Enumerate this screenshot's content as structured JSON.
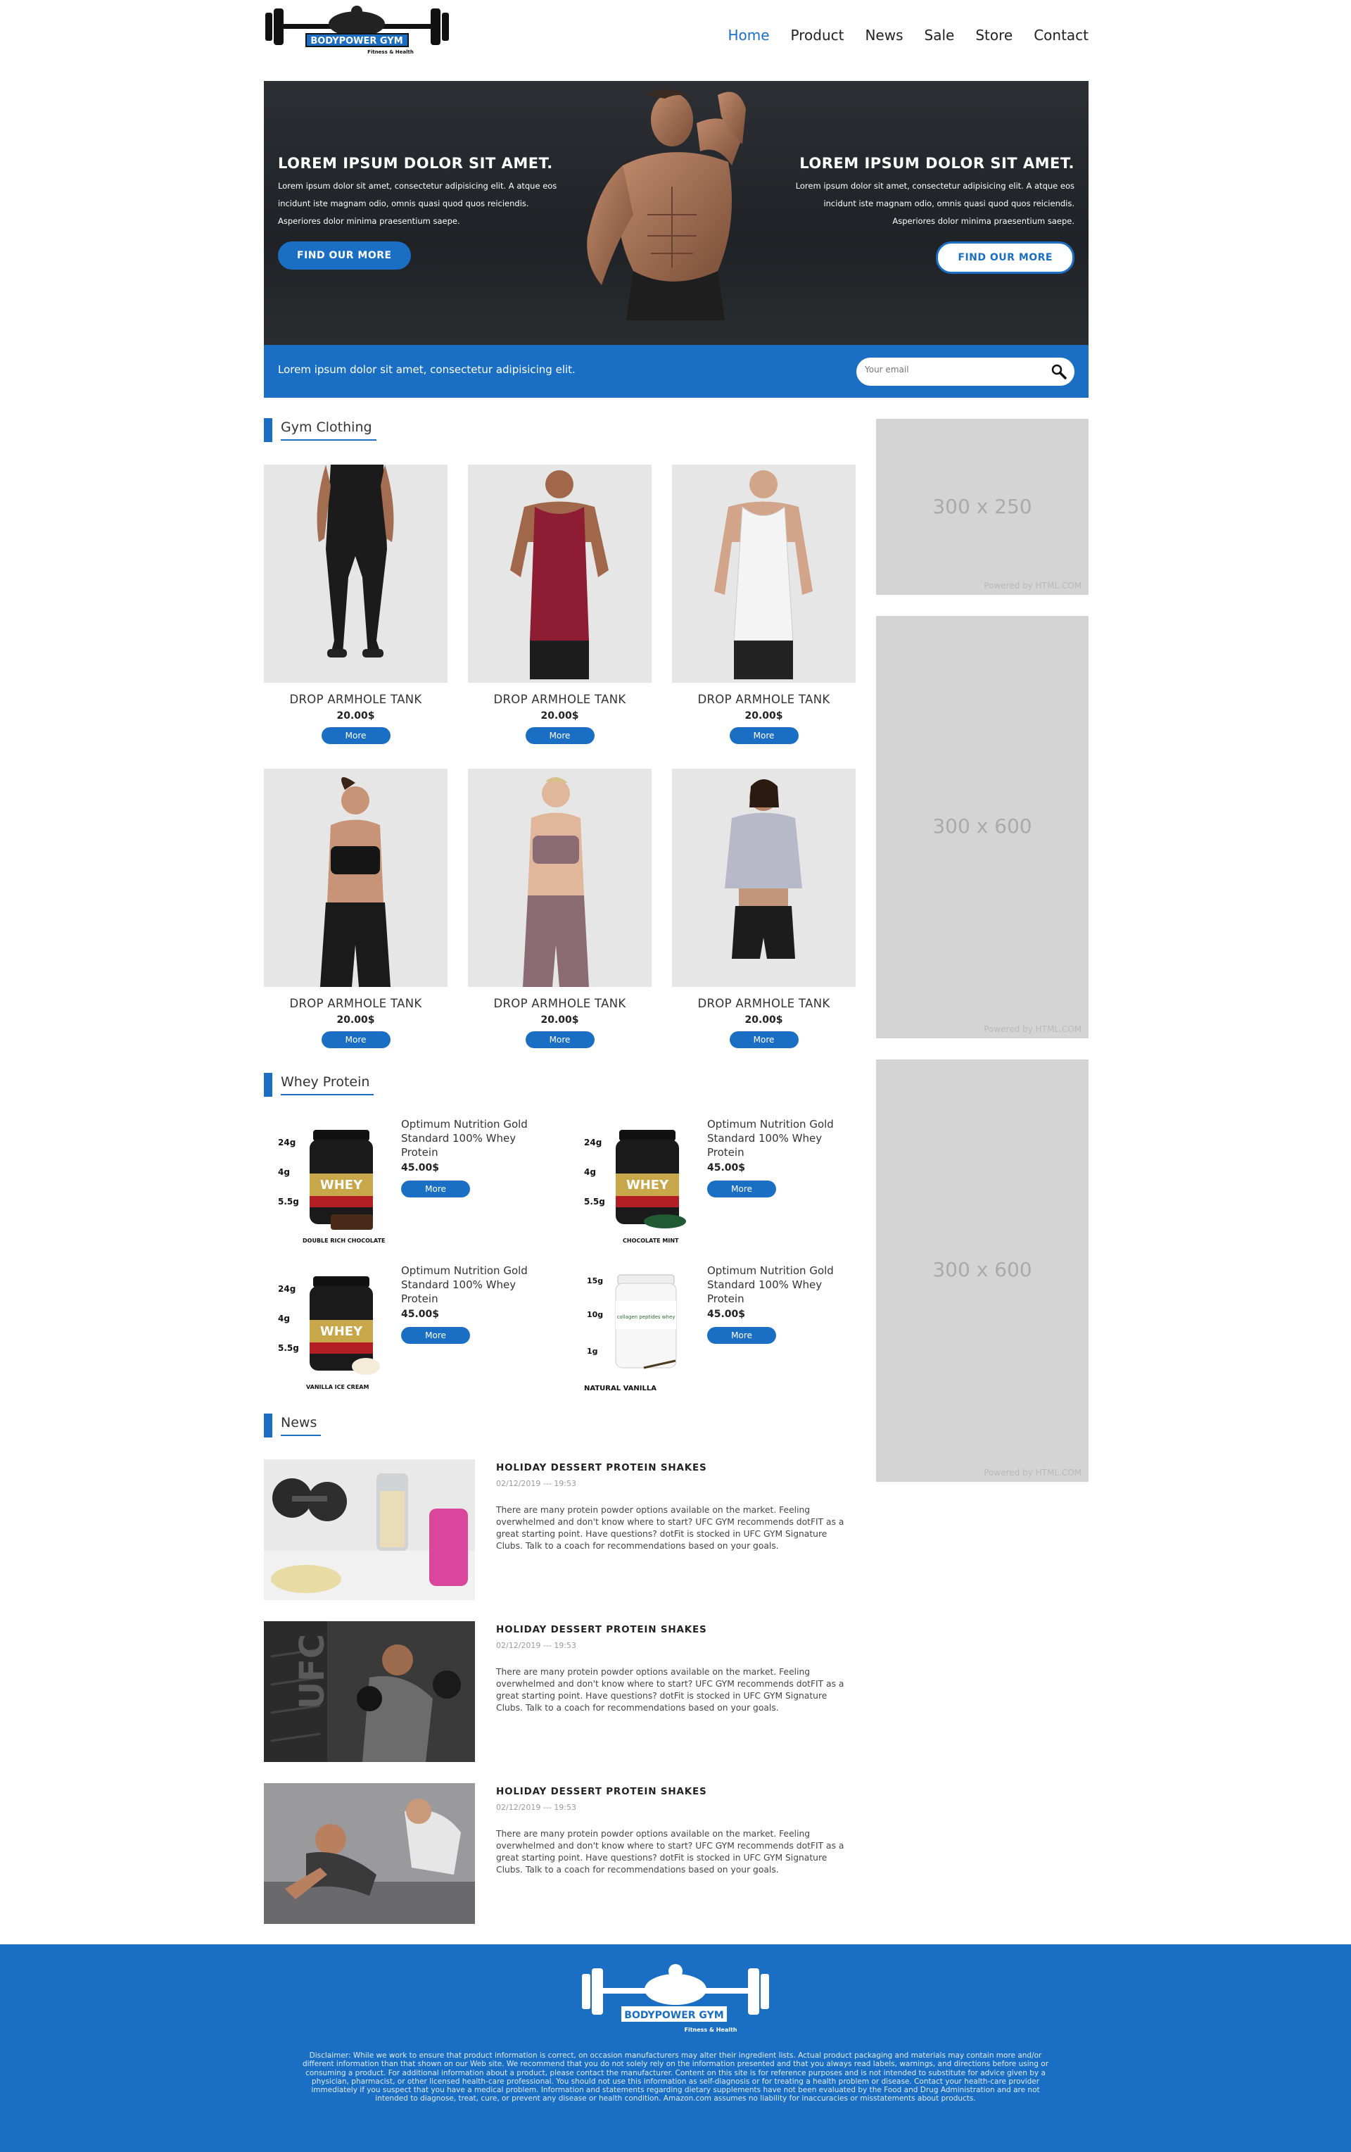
{
  "brand": {
    "logo_text": "BODYPOWER GYM",
    "logo_sub": "Fitness & Health"
  },
  "nav": [
    {
      "label": "Home",
      "active": true
    },
    {
      "label": "Product",
      "active": false
    },
    {
      "label": "News",
      "active": false
    },
    {
      "label": "Sale",
      "active": false
    },
    {
      "label": "Store",
      "active": false
    },
    {
      "label": "Contact",
      "active": false
    }
  ],
  "hero": {
    "left": {
      "title": "LOREM IPSUM DOLOR SIT AMET.",
      "lines": [
        "Lorem ipsum dolor sit amet, consectetur adipisicing elit. A atque eos",
        "incidunt iste magnam odio, omnis quasi quod quos reiciendis.",
        "Asperiores dolor minima praesentium saepe."
      ],
      "button": "FIND OUR MORE"
    },
    "right": {
      "title": "LOREM IPSUM DOLOR SIT AMET.",
      "lines": [
        "Lorem ipsum dolor sit amet, consectetur adipisicing elit. A atque eos",
        "incidunt iste magnam odio, omnis quasi quod quos reiciendis.",
        "Asperiores dolor minima praesentium saepe."
      ],
      "button": "FIND OUR MORE"
    }
  },
  "subbar": {
    "text": "Lorem ipsum dolor sit amet, consectetur adipisicing elit.",
    "email_placeholder": "Your email",
    "search_icon": "search-icon"
  },
  "sections": {
    "clothing": "Gym Clothing",
    "whey": "Whey Protein",
    "news": "News"
  },
  "clothing": [
    {
      "name": "DROP ARMHOLE TANK",
      "price": "20.00$",
      "more": "More"
    },
    {
      "name": "DROP ARMHOLE TANK",
      "price": "20.00$",
      "more": "More"
    },
    {
      "name": "DROP ARMHOLE TANK",
      "price": "20.00$",
      "more": "More"
    },
    {
      "name": "DROP ARMHOLE TANK",
      "price": "20.00$",
      "more": "More"
    },
    {
      "name": "DROP ARMHOLE TANK",
      "price": "20.00$",
      "more": "More"
    },
    {
      "name": "DROP ARMHOLE TANK",
      "price": "20.00$",
      "more": "More"
    }
  ],
  "whey": [
    {
      "name": "Optimum Nutrition Gold Standard 100% Whey Protein",
      "price": "45.00$",
      "more": "More",
      "flavor": "DOUBLE RICH CHOCOLATE",
      "label": "WHEY",
      "stats": [
        "24g",
        "4g",
        "5.5g"
      ]
    },
    {
      "name": "Optimum Nutrition Gold Standard 100% Whey Protein",
      "price": "45.00$",
      "more": "More",
      "flavor": "CHOCOLATE MINT",
      "label": "WHEY",
      "stats": [
        "24g",
        "4g",
        "5.5g"
      ]
    },
    {
      "name": "Optimum Nutrition Gold Standard 100% Whey Protein",
      "price": "45.00$",
      "more": "More",
      "flavor": "VANILLA ICE CREAM",
      "label": "WHEY",
      "stats": [
        "24g",
        "4g",
        "5.5g"
      ]
    },
    {
      "name": "Optimum Nutrition Gold Standard 100% Whey Protein",
      "price": "45.00$",
      "more": "More",
      "flavor": "NATURAL VANILLA",
      "label": "collagen peptides whey",
      "stats": [
        "15g",
        "10g",
        "1g"
      ]
    }
  ],
  "news": [
    {
      "title": "HOLIDAY DESSERT PROTEIN SHAKES",
      "date": "02/12/2019 --- 19:53",
      "text": "There are many protein powder options available on the market. Feeling overwhelmed and don't know where to start? UFC GYM recommends dotFIT as a great starting point. Have questions? dotFit is stocked in UFC GYM Signature Clubs. Talk to a coach for recommendations based on your goals."
    },
    {
      "title": "HOLIDAY DESSERT PROTEIN SHAKES",
      "date": "02/12/2019 --- 19:53",
      "text": "There are many protein powder options available on the market. Feeling overwhelmed and don't know where to start? UFC GYM recommends dotFIT as a great starting point. Have questions? dotFit is stocked in UFC GYM Signature Clubs. Talk to a coach for recommendations based on your goals."
    },
    {
      "title": "HOLIDAY DESSERT PROTEIN SHAKES",
      "date": "02/12/2019 --- 19:53",
      "text": "There are many protein powder options available on the market. Feeling overwhelmed and don't know where to start? UFC GYM recommends dotFIT as a great starting point. Have questions? dotFit is stocked in UFC GYM Signature Clubs. Talk to a coach for recommendations based on your goals."
    }
  ],
  "ads": [
    {
      "size": "300 x 250",
      "powered": "Powered by HTML.COM"
    },
    {
      "size": "300 x 600",
      "powered": "Powered by HTML.COM"
    },
    {
      "size": "300 x 600",
      "powered": "Powered by HTML.COM"
    }
  ],
  "footer": {
    "disclaimer": "Disclaimer: While we work to ensure that product information is correct, on occasion manufacturers may alter their ingredient lists. Actual product packaging and materials may contain more and/or different information than that shown on our Web site. We recommend that you do not solely rely on the information presented and that you always read labels, warnings, and directions before using or consuming a product. For additional information about a product, please contact the manufacturer. Content on this site is for reference purposes and is not intended to substitute for advice given by a physician, pharmacist, or other licensed health-care professional. You should not use this information as self-diagnosis or for treating a health problem or disease. Contact your health-care provider immediately if you suspect that you have a medical problem. Information and statements regarding dietary supplements have not been evaluated by the Food and Drug Administration and are not intended to diagnose, treat, cure, or prevent any disease or health condition. Amazon.com assumes no liability for inaccuracies or misstatements about products."
  },
  "colors": {
    "accent": "#1a6fc4",
    "hero_bg": "#23262a",
    "ad_bg": "#d4d4d4"
  }
}
